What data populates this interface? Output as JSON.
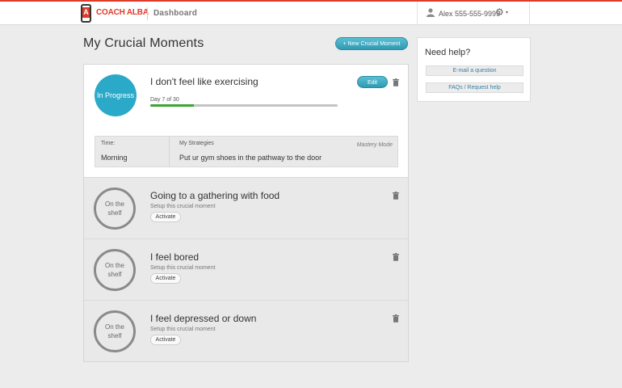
{
  "header": {
    "brand": "COACH ALBA",
    "logo_letter": "A",
    "nav_label": "Dashboard",
    "user_label": "Alex 555-555-9999",
    "user_icon": "user-icon",
    "settings_icon": "gear-icon",
    "settings_caret": "▾"
  },
  "colors": {
    "brand_red": "#e03a2a",
    "accent_blue": "#2ba9c8",
    "progress_green": "#3aa334"
  },
  "main": {
    "title": "My Crucial Moments",
    "new_button": "+ New Crucial Moment"
  },
  "active_moment": {
    "status": "In Progress",
    "title": "I don't feel like exercising",
    "day_label": "Day 7 of 30",
    "progress_fraction": 0.233,
    "edit_label": "Edit",
    "time_label": "Time:",
    "time_value": "Morning",
    "strategies_label": "My Strategies",
    "strategy_value": "Put ur gym shoes in the pathway to the door",
    "mode_label": "Mastery Mode"
  },
  "shelf": {
    "status": "On the shelf",
    "subtitle": "Setup this crucial moment",
    "activate_label": "Activate",
    "items": [
      {
        "title": "Going to a gathering with food"
      },
      {
        "title": "I feel bored"
      },
      {
        "title": "I feel depressed or down"
      }
    ]
  },
  "help": {
    "title": "Need help?",
    "email_label": "E-mail a question",
    "faq_label": "FAQs / Request help"
  }
}
